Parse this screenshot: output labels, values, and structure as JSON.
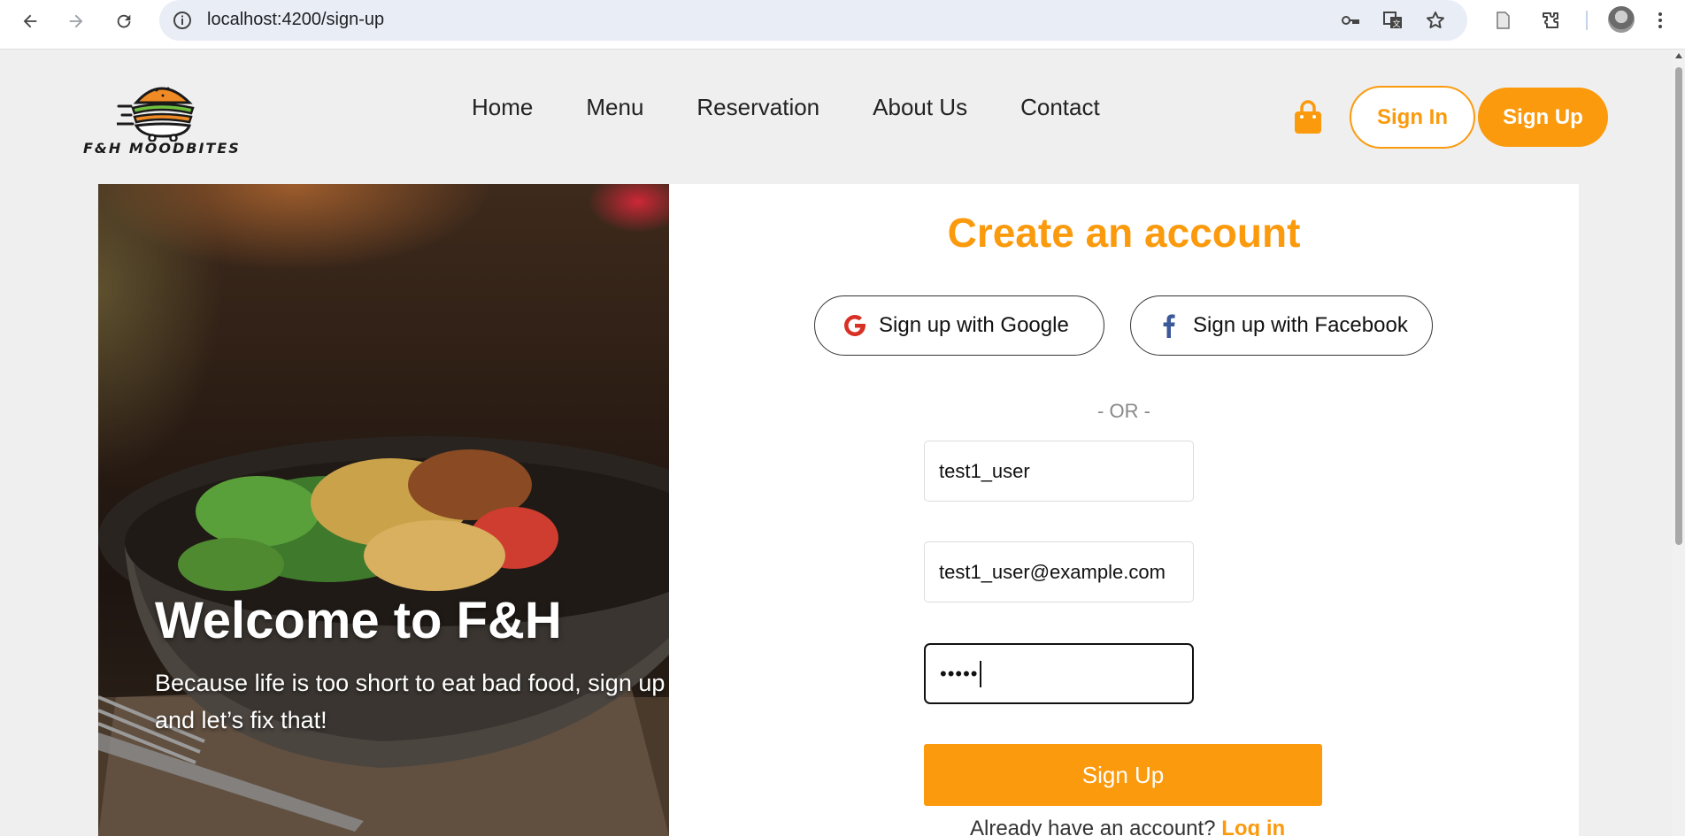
{
  "browser": {
    "url": "localhost:4200/sign-up",
    "icons": [
      "back-icon",
      "forward-icon",
      "reload-icon",
      "info-icon",
      "password-key-icon",
      "translate-icon",
      "bookmark-star-icon",
      "reading-list-icon",
      "extensions-icon",
      "profile-avatar",
      "menu-dots-icon"
    ]
  },
  "site": {
    "logo_text": "F&H MOODBITES",
    "nav": [
      "Home",
      "Menu",
      "Reservation",
      "About Us",
      "Contact"
    ],
    "sign_in_label": "Sign In",
    "sign_up_label": "Sign Up",
    "cart_icon": "shopping-bag-icon"
  },
  "hero": {
    "welcome": "Welcome to F&H",
    "tagline": "Because life is too short to eat bad food, sign up and let’s fix that!"
  },
  "form": {
    "title": "Create an account",
    "google_label": "Sign up with Google",
    "facebook_label": "Sign up with Facebook",
    "or_text": "- OR -",
    "username_value": "test1_user",
    "email_value": "test1_user@example.com",
    "password_masked": "•••••",
    "submit_label": "Sign Up",
    "login_prompt": "Already have an account?",
    "login_link": "Log in"
  },
  "colors": {
    "accent": "#fb9a0c",
    "background": "#efefef",
    "card": "#ffffff"
  }
}
